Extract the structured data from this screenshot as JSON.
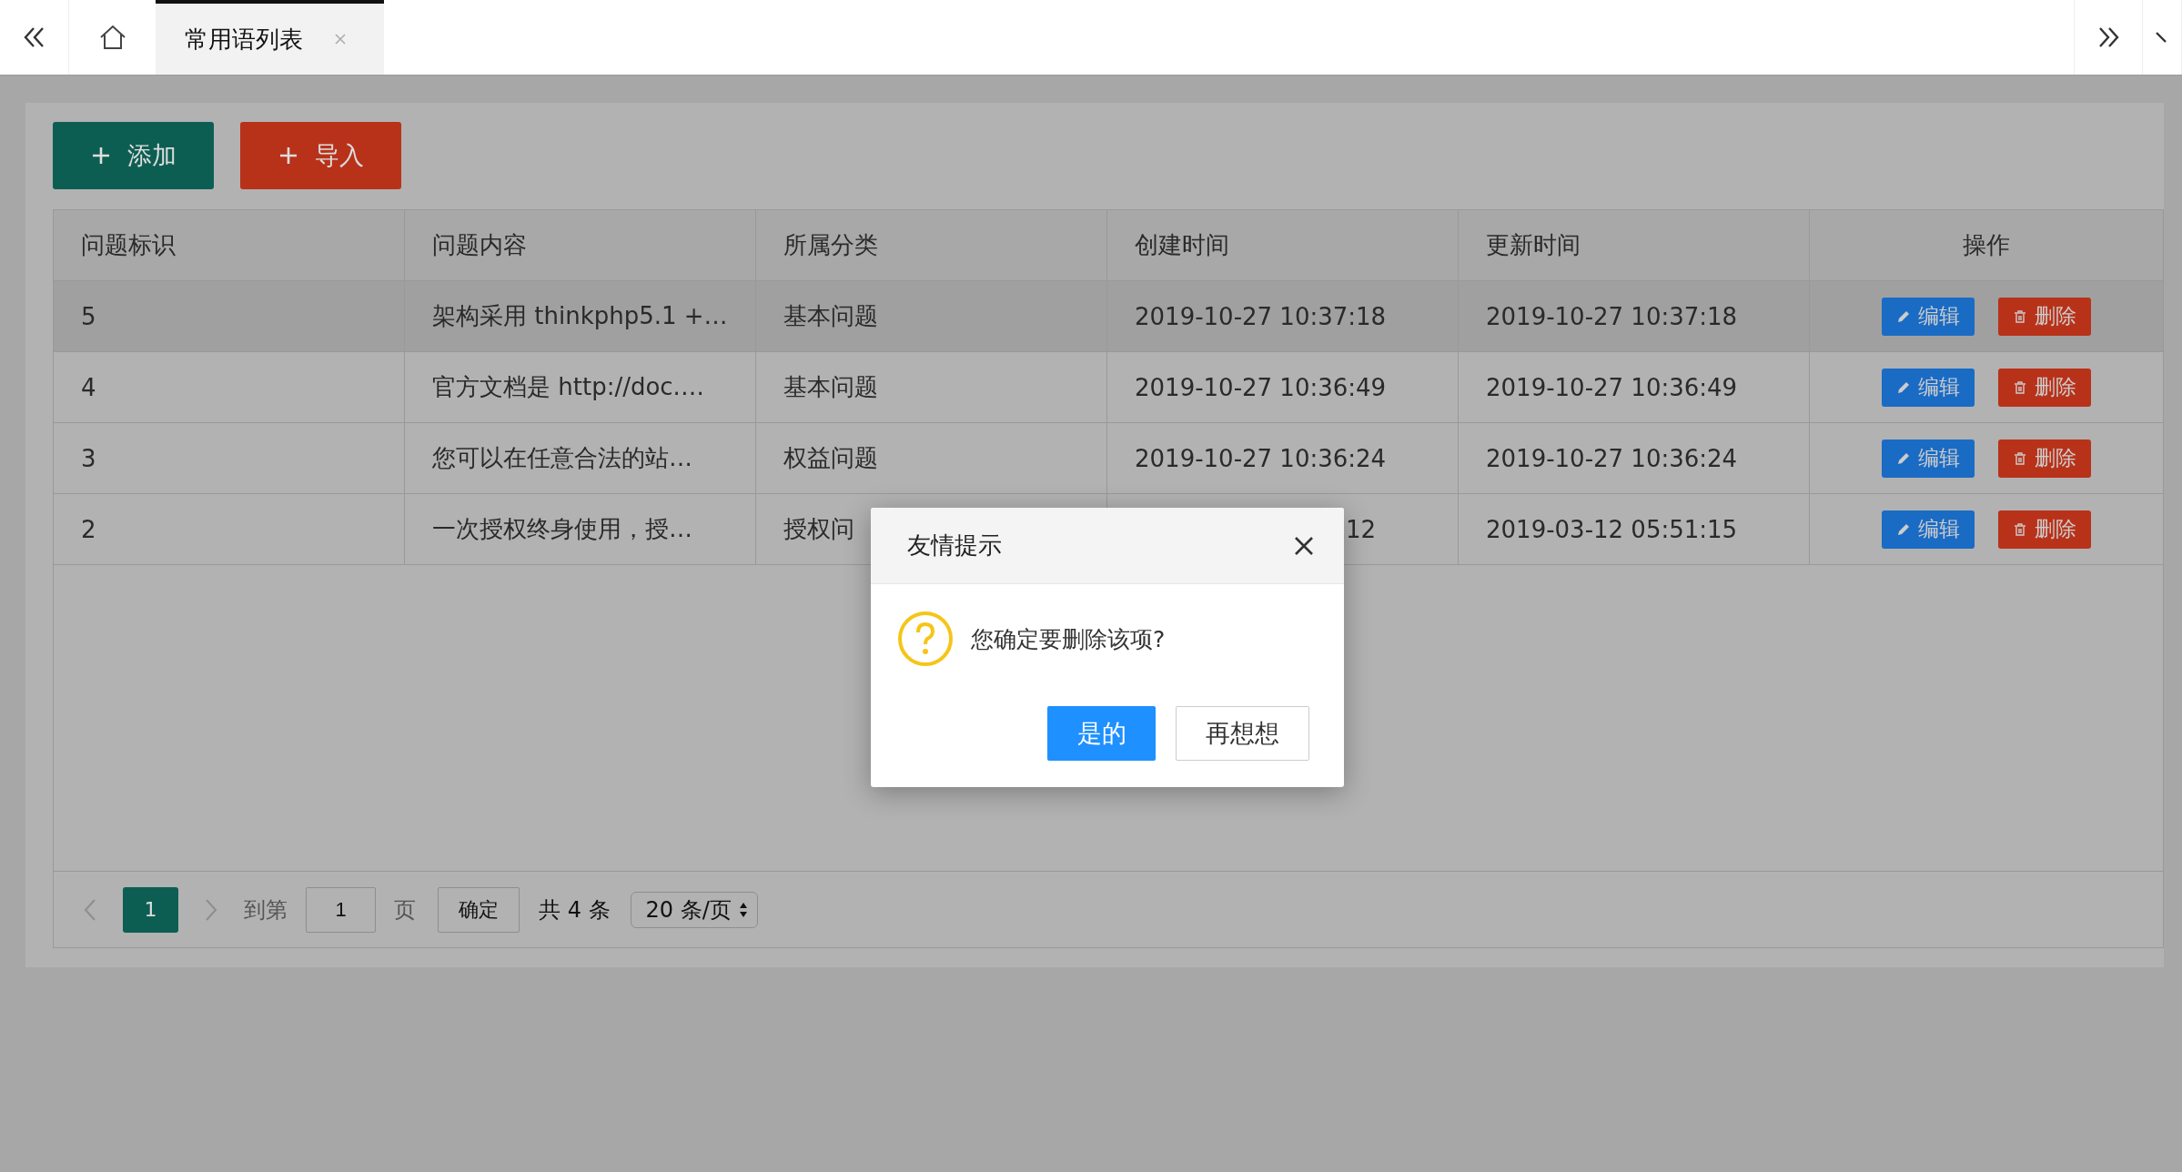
{
  "nav": {
    "tabs": [
      {
        "label": "常用语列表",
        "selected": true
      }
    ]
  },
  "toolbar": {
    "buttons": [
      {
        "label": "添加",
        "kind": "add"
      },
      {
        "label": "导入",
        "kind": "import"
      }
    ]
  },
  "table": {
    "columns": [
      "问题标识",
      "问题内容",
      "所属分类",
      "创建时间",
      "更新时间",
      "操作"
    ],
    "rows": [
      {
        "id": "5",
        "content": "架构采用 thinkphp5.1 +…",
        "category": "基本问题",
        "created": "2019-10-27 10:37:18",
        "updated": "2019-10-27 10:37:18",
        "hovered": true,
        "obscured": false,
        "actions": [
          "编辑",
          "删除"
        ]
      },
      {
        "id": "4",
        "content": "官方文档是 http://doc.…",
        "category": "基本问题",
        "created": "2019-10-27 10:36:49",
        "updated": "2019-10-27 10:36:49",
        "hovered": false,
        "obscured": false,
        "actions": [
          "编辑",
          "删除"
        ]
      },
      {
        "id": "3",
        "content": "您可以在任意合法的站…",
        "category": "权益问题",
        "created": "2019-10-27 10:36:24",
        "updated": "2019-10-27 10:36:24",
        "hovered": false,
        "obscured": false,
        "actions": [
          "编辑",
          "删除"
        ]
      },
      {
        "id": "2",
        "content": "一次授权终身使用，授…",
        "category": "授权问",
        "created": "12",
        "updated": "2019-03-12 05:51:15",
        "hovered": false,
        "obscured": true,
        "actions": [
          "编辑",
          "删除"
        ]
      }
    ]
  },
  "pagination": {
    "prev_disabled": true,
    "next_disabled": true,
    "pages": [
      {
        "label": "1",
        "selected": true
      }
    ],
    "goto_label": "到第",
    "goto_value": "1",
    "page_unit": "页",
    "confirm": "确定",
    "total": "共 4 条",
    "page_size": "20 条/页"
  },
  "dialog": {
    "title": "友情提示",
    "message": "您确定要删除该项?",
    "buttons": [
      {
        "label": "是的",
        "kind": "primary"
      },
      {
        "label": "再想想",
        "kind": "default"
      }
    ]
  }
}
